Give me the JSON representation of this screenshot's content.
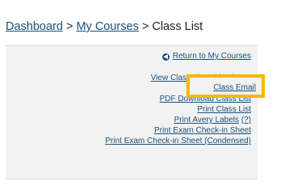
{
  "breadcrumb": {
    "dashboard": "Dashboard",
    "sep1": ">",
    "my_courses": "My Courses",
    "sep2": ">",
    "current": "Class List"
  },
  "panel": {
    "return_link": "Return to My Courses",
    "links": [
      "View Class List With Photos",
      "Class Email",
      "PDF Download Class List",
      "Print Class List",
      "Print Avery Labels",
      "Print Exam Check-in Sheet",
      "Print Exam Check-in Sheet (Condensed)"
    ],
    "avery_help": "(?)"
  },
  "colors": {
    "link": "#1a4f7a",
    "highlight": "#f5b800",
    "panel_bg": "#f2f2f2"
  },
  "icons": {
    "return": "circle-arrow-left-icon"
  }
}
